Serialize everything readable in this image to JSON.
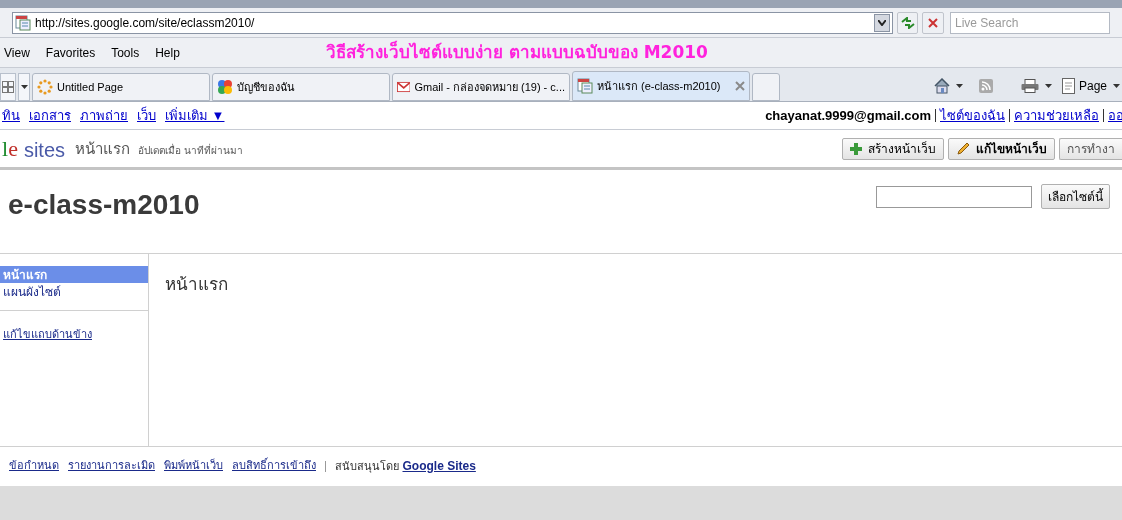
{
  "browser": {
    "url": "http://sites.google.com/site/eclassm2010/",
    "search": {
      "placeholder": "Live Search"
    },
    "menu": [
      "View",
      "Favorites",
      "Tools",
      "Help"
    ],
    "banner": "วิธีสร้างเว็บไซต์แบบง่าย ตามแบบฉบับของ M2010",
    "tabs": [
      {
        "label": "Untitled Page",
        "kind": "loading",
        "selected": false
      },
      {
        "label": "บัญชีของฉัน",
        "kind": "google",
        "selected": false
      },
      {
        "label": "Gmail - กล่องจดหมาย (19) - c...",
        "kind": "gmail",
        "selected": false
      },
      {
        "label": "หน้าแรก (e-class-m2010)",
        "kind": "sites",
        "selected": true
      }
    ],
    "page_menu": "Page"
  },
  "google_bar": {
    "links": [
      "ทิน",
      "เอกสาร",
      "ภาพถ่าย",
      "เว็บ",
      "เพิ่มเติม ▼"
    ],
    "email": "chayanat.9999@gmail.com",
    "account_links": [
      "ไซต์ของฉัน",
      "ความช่วยเหลือ",
      "ออ"
    ]
  },
  "header": {
    "logo_fragment": "le",
    "logo_word": "sites",
    "page_name": "หน้าแรก",
    "updated": "อัปเดตเมื่อ นาทีที่ผ่านมา",
    "buttons": [
      {
        "label": "สร้างหน้าเว็บ",
        "kind": "add"
      },
      {
        "label": "แก้ไขหน้าเว็บ",
        "kind": "edit"
      },
      {
        "label": "การทำงา",
        "kind": "plain"
      }
    ]
  },
  "site": {
    "title": "e-class-m2010",
    "search_button": "เลือกไซต์นี้"
  },
  "sidebar": {
    "items": [
      {
        "label": "หน้าแรก",
        "selected": true
      },
      {
        "label": "แผนผังไซต์",
        "selected": false
      }
    ],
    "edit_link": "แก้ไขแถบด้านข้าง"
  },
  "content": {
    "heading": "หน้าแรก"
  },
  "footer": {
    "links": [
      "ข้อกำหนด",
      "รายงานการละเมิด",
      "พิมพ์หน้าเว็บ",
      "ลบสิทธิ์การเข้าถึง"
    ],
    "powered_by": "สนับสนุนโดย",
    "powered_link": "Google Sites"
  }
}
